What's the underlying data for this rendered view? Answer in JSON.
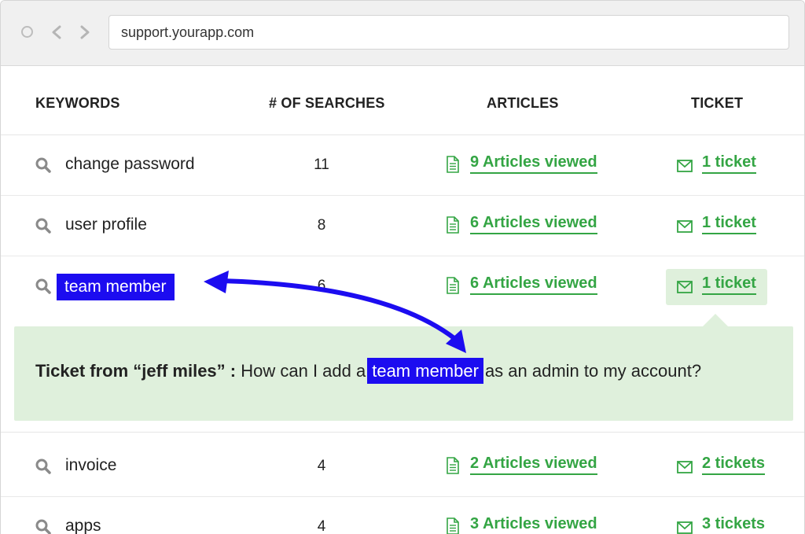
{
  "browser": {
    "url": "support.yourapp.com"
  },
  "table": {
    "headers": {
      "keywords": "KEYWORDS",
      "searches": "# OF SEARCHES",
      "articles": "ARTICLES",
      "ticket": "TICKET"
    },
    "rows": [
      {
        "keyword": "change password",
        "searches": "11",
        "articles": "9 Articles viewed",
        "tickets": "1 ticket"
      },
      {
        "keyword": "user profile",
        "searches": "8",
        "articles": "6 Articles viewed",
        "tickets": "1 ticket"
      },
      {
        "keyword": "team member",
        "searches": "6",
        "articles": "6 Articles viewed",
        "tickets": "1 ticket"
      },
      {
        "keyword": "invoice",
        "searches": "4",
        "articles": "2 Articles viewed",
        "tickets": "2 tickets"
      },
      {
        "keyword": "apps",
        "searches": "4",
        "articles": "3 Articles viewed",
        "tickets": "3 tickets"
      }
    ]
  },
  "ticket_detail": {
    "label": "Ticket from “jeff miles” :",
    "text_before": "How can I add a",
    "highlight": "team member",
    "text_after": "as an admin to my account?"
  },
  "colors": {
    "link_green": "#34a544",
    "highlight_blue": "#1c0cf0",
    "panel_green": "#dff0dc"
  }
}
